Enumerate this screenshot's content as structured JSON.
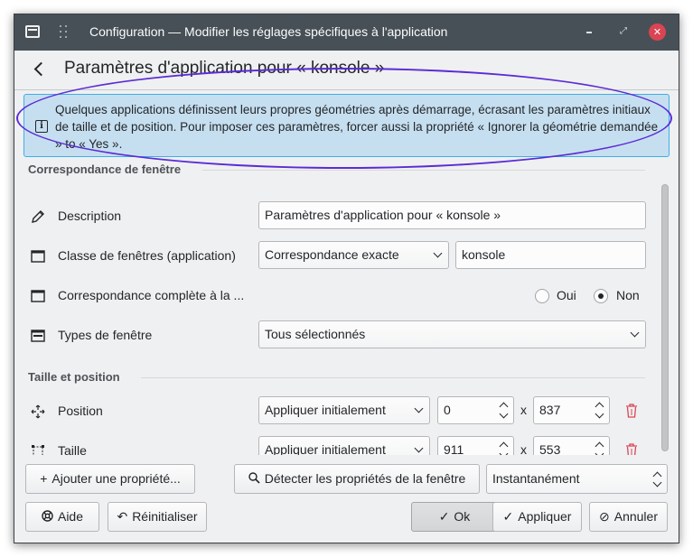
{
  "window": {
    "title": "Configuration — Modifier les réglages spécifiques à l'application"
  },
  "header": {
    "title": "Paramètres d'application pour « konsole »"
  },
  "info": {
    "text": "Quelques applications définissent leurs propres géométries après démarrage, écrasant les paramètres initiaux de taille et de position. Pour imposer ces paramètres, forcer aussi la propriété « Ignorer la géométrie demandée » to « Yes »."
  },
  "sections": {
    "window_match": "Correspondance de fenêtre",
    "size_position": "Taille et position"
  },
  "rows": {
    "description": {
      "label": "Description",
      "value": "Paramètres d'application pour « konsole »"
    },
    "window_class": {
      "label": "Classe de fenêtres (application)",
      "match_type": "Correspondance exacte",
      "value": "konsole"
    },
    "whole_class": {
      "label": "Correspondance complète à la ...",
      "yes_label": "Oui",
      "no_label": "Non",
      "selected": "Non"
    },
    "window_types": {
      "label": "Types de fenêtre",
      "value": "Tous sélectionnés"
    },
    "position": {
      "label": "Position",
      "policy": "Appliquer initialement",
      "x": "0",
      "separator": "x",
      "y": "837"
    },
    "size": {
      "label": "Taille",
      "policy": "Appliquer initialement",
      "width": "911",
      "separator": "x",
      "height": "553"
    }
  },
  "toolbar": {
    "add_property": "Ajouter une propriété...",
    "detect_properties": "Détecter les propriétés de la fenêtre",
    "detect_delay": "Instantanément"
  },
  "buttons": {
    "help": "Aide",
    "reset": "Réinitialiser",
    "ok": "Ok",
    "apply": "Appliquer",
    "cancel": "Annuler"
  },
  "colors": {
    "titlebar": "#475057",
    "info_bg": "#c6dff0",
    "info_border": "#3daee9",
    "annotation": "#5b2bd6",
    "close_button": "#da4453",
    "delete_icon": "#da4453"
  },
  "icons": {
    "app": "window-icon",
    "pin": "pin-icon",
    "back": "back-arrow-icon",
    "info": "info-icon",
    "description": "pencil-icon",
    "window_class": "window-icon",
    "whole_class": "window-icon",
    "window_types": "window-list-icon",
    "position": "move-icon",
    "size": "resize-icon",
    "delete": "trash-icon"
  }
}
